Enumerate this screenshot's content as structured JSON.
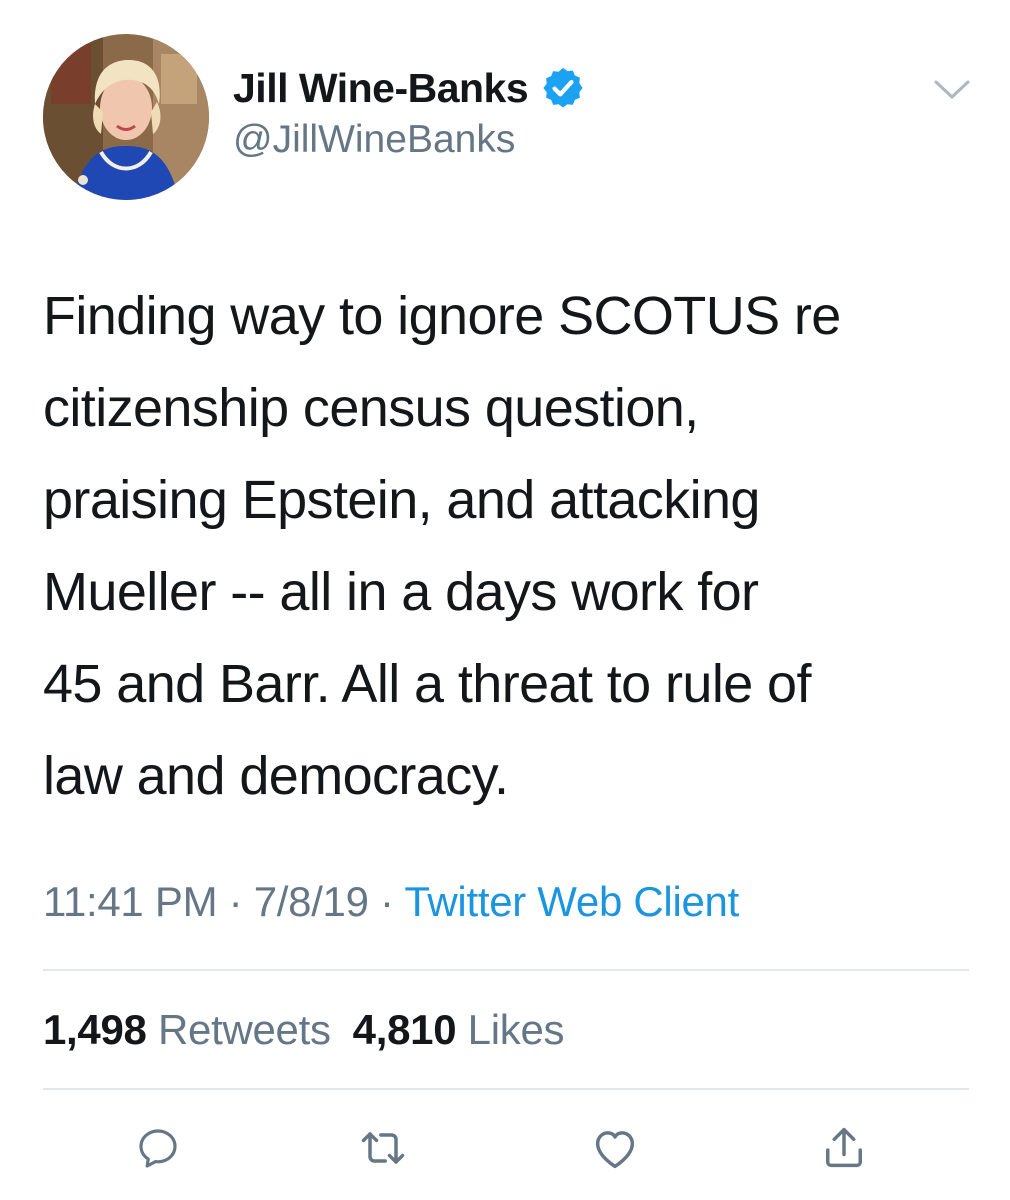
{
  "user": {
    "display_name": "Jill Wine-Banks",
    "handle": "@JillWineBanks",
    "verified": true,
    "avatar_icon": "profile-photo"
  },
  "tweet": {
    "text_lines": [
      "Finding way to ignore SCOTUS re",
      "citizenship census question,",
      "praising Epstein, and attacking",
      "Mueller -- all in a days work for",
      "45 and Barr. All a threat to rule of",
      "law and democracy."
    ]
  },
  "meta": {
    "time": "11:41 PM",
    "separator": " · ",
    "date": "7/8/19",
    "source": "Twitter Web Client"
  },
  "stats": {
    "retweets_count": "1,498",
    "retweets_label": "Retweets",
    "likes_count": "4,810",
    "likes_label": "Likes"
  },
  "actions": [
    {
      "icon": "reply-icon"
    },
    {
      "icon": "retweet-icon"
    },
    {
      "icon": "like-icon"
    },
    {
      "icon": "share-icon"
    }
  ],
  "colors": {
    "text": "#14171a",
    "secondary": "#657786",
    "link": "#1b95e0",
    "verified": "#1da1f2",
    "divider": "#e1e8ed",
    "icon": "#657786"
  }
}
